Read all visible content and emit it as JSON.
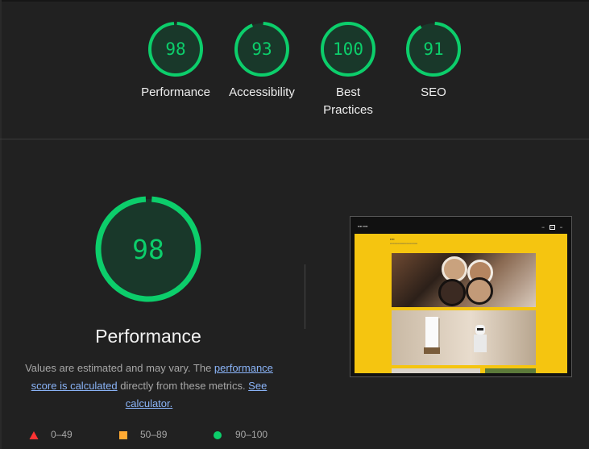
{
  "categories": [
    {
      "score": "98",
      "label": "Performance"
    },
    {
      "score": "93",
      "label": "Accessibility"
    },
    {
      "score": "100",
      "label": "Best Practices"
    },
    {
      "score": "91",
      "label": "SEO"
    }
  ],
  "performance": {
    "score": "98",
    "title": "Performance",
    "desc_part1": "Values are estimated and may vary. The ",
    "link_calc": "performance score is calculated",
    "desc_part2": " directly from these metrics. ",
    "link_see": "See calculator."
  },
  "legend": [
    {
      "range": "0–49",
      "color": "#ff3333",
      "shape": "triangle-icon"
    },
    {
      "range": "50–89",
      "color": "#ffaa33",
      "shape": "square-icon"
    },
    {
      "range": "90–100",
      "color": "#0cce6b",
      "shape": "circle-icon"
    }
  ],
  "colors": {
    "pass": "#0cce6b",
    "pass_bg": "#19382a",
    "link": "#8ab4f8"
  }
}
